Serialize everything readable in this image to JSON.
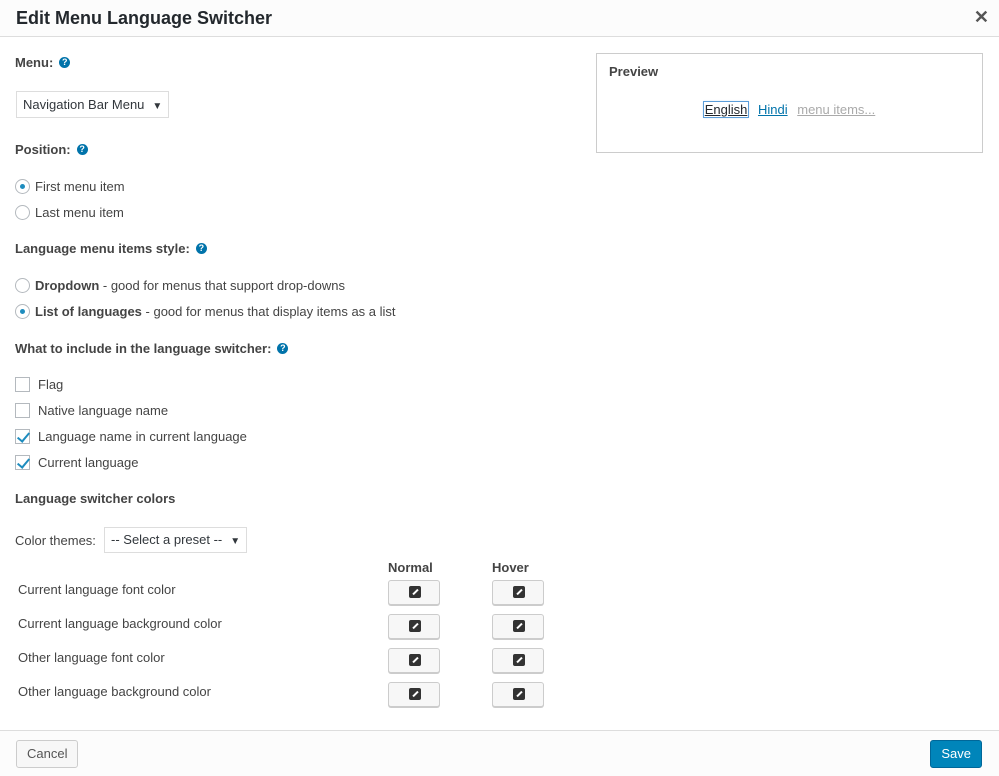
{
  "dialog": {
    "title": "Edit Menu Language Switcher",
    "close_icon": "close-icon"
  },
  "menu": {
    "label": "Menu:",
    "selected": "Navigation Bar Menu"
  },
  "position": {
    "label": "Position:",
    "options": [
      "First menu item",
      "Last menu item"
    ],
    "selected": "First menu item"
  },
  "style": {
    "label": "Language menu items style:",
    "options": [
      {
        "name": "Dropdown",
        "desc": " - good for menus that support drop-downs"
      },
      {
        "name": "List of languages",
        "desc": " - good for menus that display items as a list"
      }
    ],
    "selected": "List of languages"
  },
  "include": {
    "label": "What to include in the language switcher:",
    "options": [
      {
        "label": "Flag",
        "checked": false
      },
      {
        "label": "Native language name",
        "checked": false
      },
      {
        "label": "Language name in current language",
        "checked": true
      },
      {
        "label": "Current language",
        "checked": true
      }
    ]
  },
  "colors": {
    "heading": "Language switcher colors",
    "themes_label": "Color themes:",
    "themes_selected": "-- Select a preset --",
    "col_normal": "Normal",
    "col_hover": "Hover",
    "rows": [
      "Current language font color",
      "Current language background color",
      "Other language font color",
      "Other language background color"
    ]
  },
  "preview": {
    "title": "Preview",
    "links": [
      "English",
      "Hindi",
      "menu items..."
    ]
  },
  "footer": {
    "cancel": "Cancel",
    "save": "Save"
  },
  "accent": "#0073aa"
}
